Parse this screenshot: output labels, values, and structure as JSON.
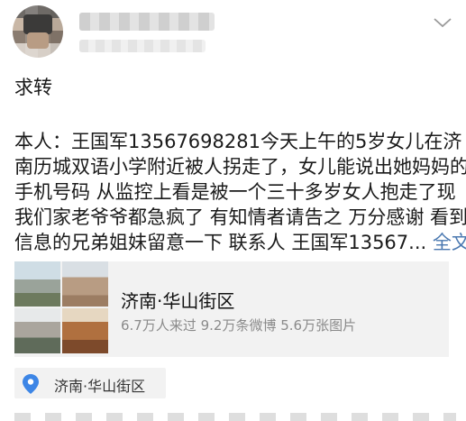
{
  "post": {
    "title": "求转",
    "body_lines": [
      "本人：王国军13567698281今天上午的5岁女儿在济",
      "南历城双语小学附近被人拐走了，女儿能说出她妈妈的",
      "手机号码 从监控上看是被一个三十多岁女人抱走了现",
      "我们家老爷爷都急疯了 有知情者请告之 万分感谢 看到",
      "信息的兄弟姐妹留意一下 联系人 王国军13567..."
    ],
    "more_link": "全文"
  },
  "place_card": {
    "title": "济南·华山街区",
    "stats": "6.7万人来过 9.2万条微博 5.6万张图片"
  },
  "location_tag": {
    "label": "济南·华山街区"
  },
  "colors": {
    "link": "#4a78b0",
    "pin": "#3d86e6",
    "card_bg": "#f2f2f2"
  },
  "icons": {
    "chevron": "chevron-down-icon",
    "pin": "location-pin-icon"
  }
}
